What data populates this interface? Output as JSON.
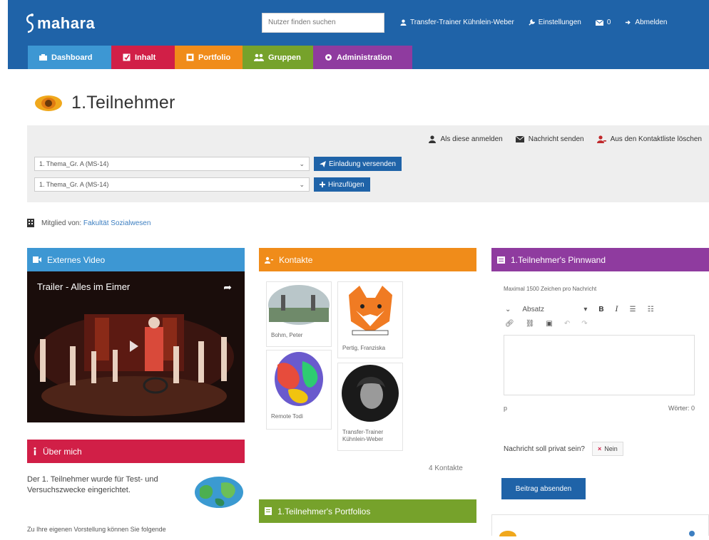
{
  "header": {
    "logo": "mahara",
    "search_placeholder": "Nutzer finden suchen",
    "user_menu": [
      {
        "icon": "user-icon",
        "label": "Transfer-Trainer Kühnlein-Weber"
      },
      {
        "icon": "wrench-icon",
        "label": "Einstellungen"
      },
      {
        "icon": "envelope-icon",
        "label": "0"
      },
      {
        "icon": "logout-icon",
        "label": "Abmelden"
      }
    ],
    "tabs": [
      {
        "icon": "dashboard-icon",
        "label": "Dashboard",
        "color": "#3d97d3"
      },
      {
        "icon": "edit-icon",
        "label": "Inhalt",
        "color": "#d11f47"
      },
      {
        "icon": "folder-icon",
        "label": "Portfolio",
        "color": "#f08c1a"
      },
      {
        "icon": "users-icon",
        "label": "Gruppen",
        "color": "#76a22b"
      },
      {
        "icon": "gear-icon",
        "label": "Administration",
        "color": "#8f3b9f"
      }
    ]
  },
  "profile": {
    "name": "1.Teilnehmer",
    "actions": [
      {
        "icon": "user-icon",
        "label": "Als diese anmelden"
      },
      {
        "icon": "envelope-icon",
        "label": "Nachricht senden"
      },
      {
        "icon": "remove-user-icon",
        "label": "Aus den Kontaktliste löschen"
      }
    ],
    "group_select_1": "1. Thema_Gr. A (MS-14)",
    "group_select_2": "1. Thema_Gr. A (MS-14)",
    "invite_button": "Einladung versenden",
    "add_button": "Hinzufügen",
    "member_prefix": "Mitglied von:",
    "member_institution": "Fakultät Sozialwesen"
  },
  "blocks": {
    "video": {
      "title": "Externes Video",
      "video_title": "Trailer - Alles im Eimer"
    },
    "about": {
      "title": "Über mich",
      "text": "Der 1. Teilnehmer wurde für Test- und Versuchszwecke eingerichtet.",
      "note": "Zu Ihre eigenen Vorstellung können Sie folgende"
    },
    "contacts": {
      "title": "Kontakte",
      "people": [
        "Bohm, Peter",
        "Pertig, Franziska",
        "Remote Todi",
        "Transfer-Trainer Kühnlein-Weber"
      ],
      "count": "4 Kontakte"
    },
    "portfolio": {
      "title": "1.Teilnehmer's Portfolios"
    },
    "wall": {
      "title": "1.Teilnehmer's Pinnwand",
      "hint": "Maximal 1500 Zeichen pro Nachricht",
      "format": "Absatz",
      "path": "p",
      "words": "Wörter: 0",
      "private_question": "Nachricht soll privat sein?",
      "no_label": "Nein",
      "submit": "Beitrag absenden"
    }
  }
}
